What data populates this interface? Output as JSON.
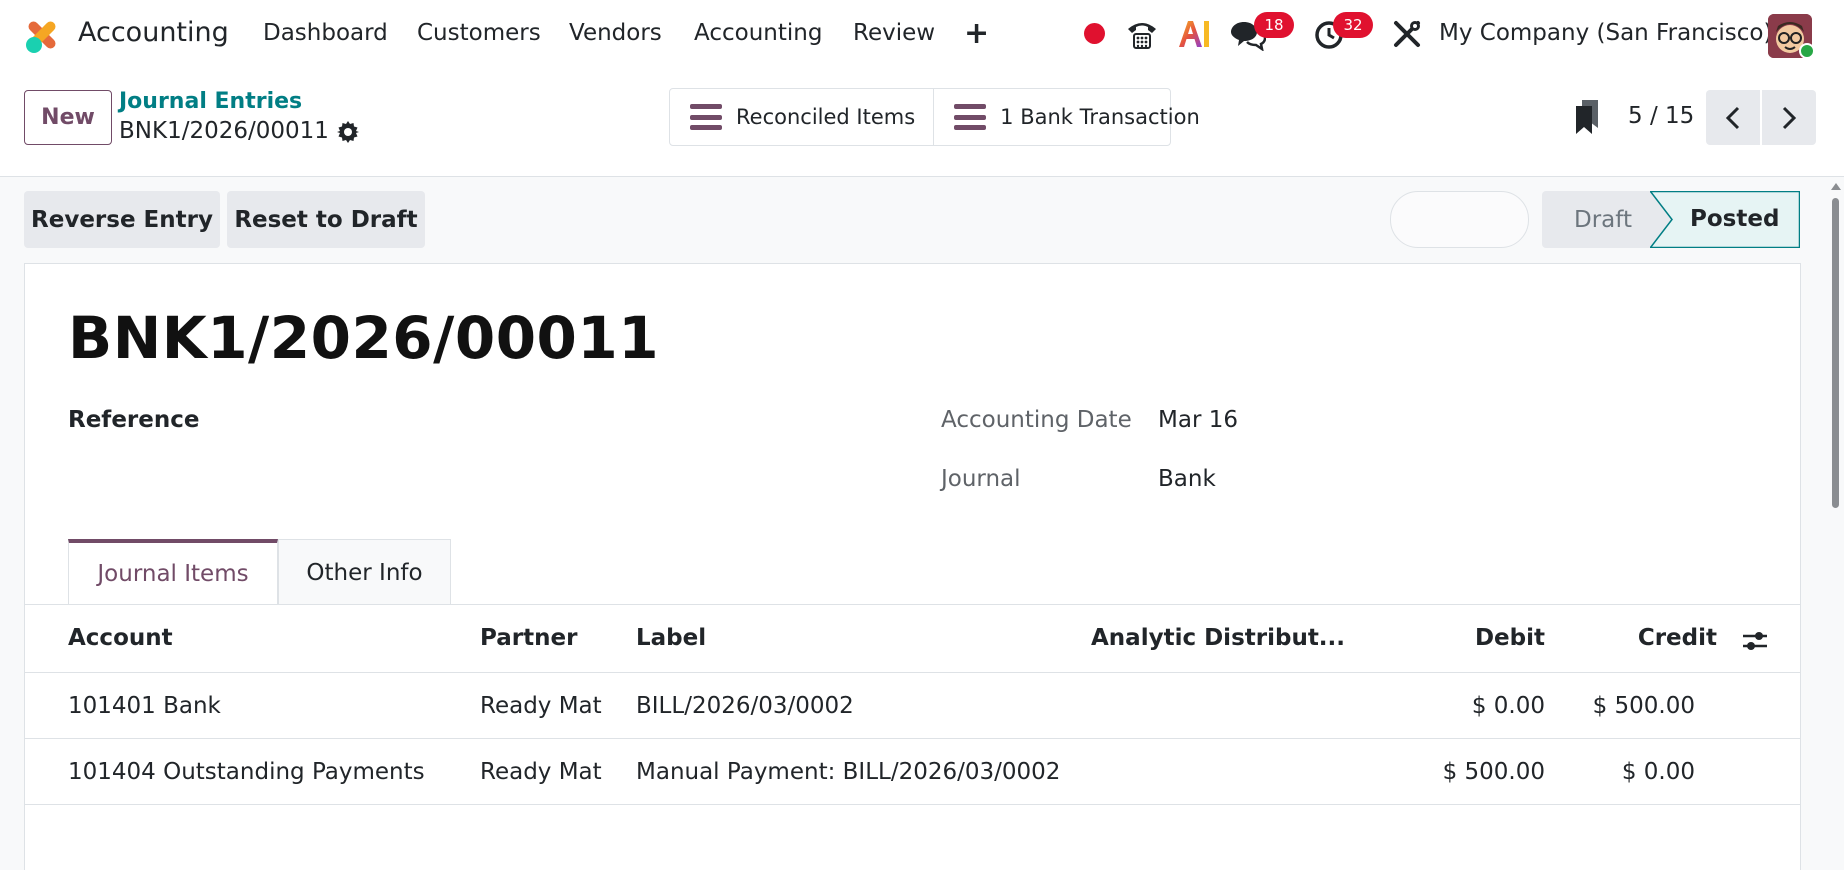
{
  "navbar": {
    "app_name": "Accounting",
    "menu": [
      "Dashboard",
      "Customers",
      "Vendors",
      "Accounting",
      "Review"
    ],
    "plus_icon": "+",
    "messages_badge": "18",
    "activities_badge": "32",
    "company": "My Company (San Francisco)",
    "colors": {
      "record": "#e0112f",
      "badge": "#e0112f",
      "brand": "#714b67"
    }
  },
  "control_panel": {
    "new_label": "New",
    "breadcrumb_parent": "Journal Entries",
    "breadcrumb_current": "BNK1/2026/00011",
    "smart_buttons": [
      "Reconciled Items",
      "1 Bank Transaction"
    ],
    "pager": "5 / 15"
  },
  "actions": {
    "reverse_entry": "Reverse Entry",
    "reset_to_draft": "Reset to Draft"
  },
  "status": {
    "stages": [
      "Draft",
      "Posted"
    ],
    "current": "Posted"
  },
  "form": {
    "title": "BNK1/2026/00011",
    "reference_label": "Reference",
    "accounting_date_label": "Accounting Date",
    "accounting_date_value": "Mar 16",
    "journal_label": "Journal",
    "journal_value": "Bank",
    "tabs": [
      "Journal Items",
      "Other Info"
    ],
    "columns": [
      "Account",
      "Partner",
      "Label",
      "Analytic Distribut...",
      "Debit",
      "Credit"
    ],
    "rows": [
      [
        "101401 Bank",
        "Ready Mat",
        "BILL/2026/03/0002",
        "",
        "$ 0.00",
        "$ 500.00"
      ],
      [
        "101404 Outstanding Payments",
        "Ready Mat",
        "Manual Payment: BILL/2026/03/0002",
        "",
        "$ 500.00",
        "$ 0.00"
      ]
    ]
  }
}
